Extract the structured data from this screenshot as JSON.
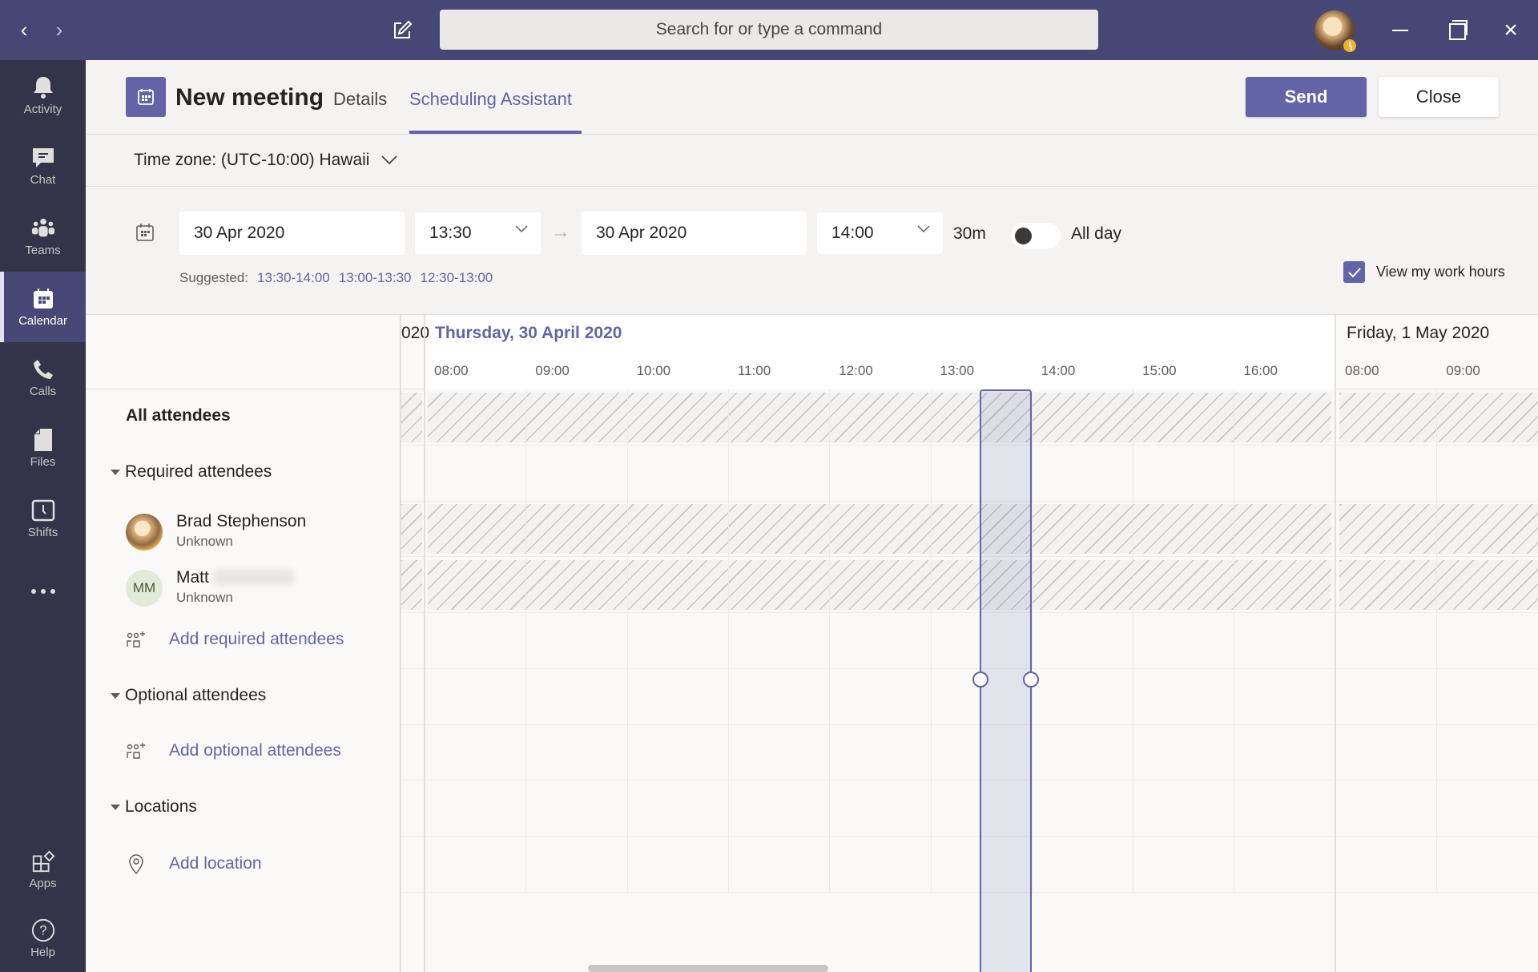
{
  "titlebar": {
    "search_placeholder": "Search for or type a command",
    "icons": [
      "chevron-left-icon",
      "chevron-right-icon",
      "compose-icon",
      "minimize-icon",
      "maximize-icon",
      "close-icon"
    ]
  },
  "rail": {
    "items": [
      {
        "label": "Activity",
        "icon": "bell-icon"
      },
      {
        "label": "Chat",
        "icon": "chat-icon"
      },
      {
        "label": "Teams",
        "icon": "teams-icon"
      },
      {
        "label": "Calendar",
        "icon": "calendar-icon",
        "active": true
      },
      {
        "label": "Calls",
        "icon": "phone-icon"
      },
      {
        "label": "Files",
        "icon": "file-icon"
      },
      {
        "label": "Shifts",
        "icon": "clock-icon"
      }
    ],
    "more": "more-icon",
    "bottom": [
      {
        "label": "Apps",
        "icon": "apps-icon"
      },
      {
        "label": "Help",
        "icon": "help-icon"
      }
    ]
  },
  "header": {
    "title": "New meeting",
    "tabs": [
      {
        "label": "Details",
        "active": false
      },
      {
        "label": "Scheduling Assistant",
        "active": true
      }
    ],
    "send_label": "Send",
    "close_label": "Close"
  },
  "timezone": {
    "label": "Time zone: (UTC-10:00) Hawaii"
  },
  "schedule": {
    "start_date": "30 Apr 2020",
    "start_time": "13:30",
    "end_date": "30 Apr 2020",
    "end_time": "14:00",
    "duration": "30m",
    "all_day_label": "All day",
    "all_day": false,
    "suggested_label": "Suggested:",
    "suggestions": [
      "13:30-14:00",
      "13:00-13:30",
      "12:30-13:00"
    ],
    "work_hours_label": "View my work hours",
    "work_hours_checked": true
  },
  "attendees": {
    "all_label": "All attendees",
    "required_label": "Required attendees",
    "required": [
      {
        "name": "Brad Stephenson",
        "status": "Unknown"
      },
      {
        "name": "Matt",
        "initials": "MM",
        "status": "Unknown",
        "surname_redacted": true
      }
    ],
    "add_required_label": "Add required attendees",
    "optional_label": "Optional attendees",
    "add_optional_label": "Add optional attendees",
    "locations_label": "Locations",
    "add_location_label": "Add location"
  },
  "timeline": {
    "prev_day_fragment": "020",
    "days": [
      {
        "label": "Thursday, 30 April 2020",
        "current": true,
        "hours": [
          "08:00",
          "09:00",
          "10:00",
          "11:00",
          "12:00",
          "13:00",
          "14:00",
          "15:00",
          "16:00"
        ]
      },
      {
        "label": "Friday, 1 May 2020",
        "current": false,
        "hours": [
          "08:00",
          "09:00"
        ]
      }
    ],
    "selection": {
      "start": "13:30",
      "end": "14:00"
    }
  },
  "colors": {
    "brand": "#6264a7",
    "titlebar": "#464775",
    "rail": "#33344a"
  }
}
